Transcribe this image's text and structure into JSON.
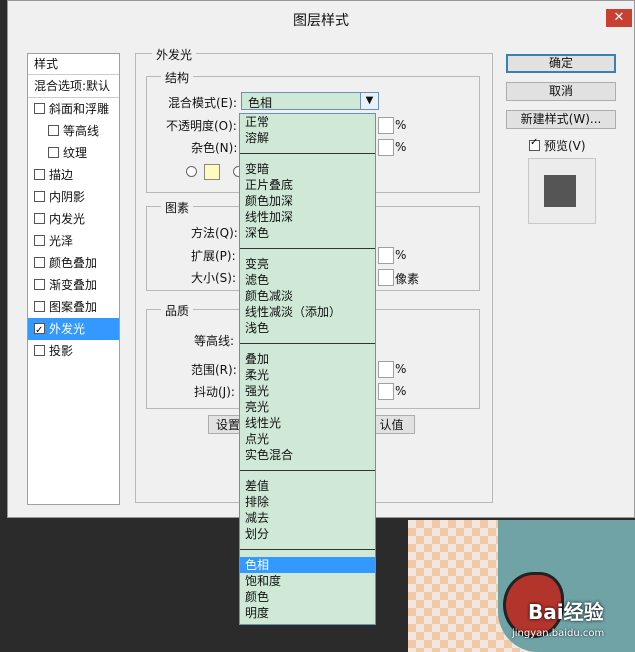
{
  "dialog": {
    "title": "图层样式",
    "close_glyph": "✕"
  },
  "styles_list": {
    "header": "样式",
    "blend_default": "混合选项:默认",
    "items": [
      {
        "label": "斜面和浮雕",
        "checked": false,
        "indent": false,
        "active": false
      },
      {
        "label": "等高线",
        "checked": false,
        "indent": true,
        "active": false
      },
      {
        "label": "纹理",
        "checked": false,
        "indent": true,
        "active": false
      },
      {
        "label": "描边",
        "checked": false,
        "indent": false,
        "active": false
      },
      {
        "label": "内阴影",
        "checked": false,
        "indent": false,
        "active": false
      },
      {
        "label": "内发光",
        "checked": false,
        "indent": false,
        "active": false
      },
      {
        "label": "光泽",
        "checked": false,
        "indent": false,
        "active": false
      },
      {
        "label": "颜色叠加",
        "checked": false,
        "indent": false,
        "active": false
      },
      {
        "label": "渐变叠加",
        "checked": false,
        "indent": false,
        "active": false
      },
      {
        "label": "图案叠加",
        "checked": false,
        "indent": false,
        "active": false
      },
      {
        "label": "外发光",
        "checked": true,
        "indent": false,
        "active": true
      },
      {
        "label": "投影",
        "checked": false,
        "indent": false,
        "active": false
      }
    ]
  },
  "panel": {
    "title": "外发光",
    "structure": {
      "title": "结构",
      "blend_mode_label": "混合模式(E):",
      "blend_mode_value": "色相",
      "opacity_label": "不透明度(O):",
      "noise_label": "杂色(N):",
      "percent": "%"
    },
    "elements": {
      "title": "图素",
      "method_label": "方法(Q):",
      "spread_label": "扩展(P):",
      "size_label": "大小(S):",
      "percent": "%",
      "pixels": "像素"
    },
    "quality": {
      "title": "品质",
      "contour_label": "等高线:",
      "range_label": "范围(R):",
      "jitter_label": "抖动(J):",
      "percent": "%"
    },
    "buttons": {
      "set_default_partial": "设置",
      "reset_default_partial": "认值"
    }
  },
  "right_buttons": {
    "ok": "确定",
    "cancel": "取消",
    "new_style": "新建样式(W)...",
    "preview": "预览(V)",
    "preview_checked": true
  },
  "dropdown": {
    "groups": [
      [
        "正常",
        "溶解"
      ],
      [
        "变暗",
        "正片叠底",
        "颜色加深",
        "线性加深",
        "深色"
      ],
      [
        "变亮",
        "滤色",
        "颜色减淡",
        "线性减淡（添加）",
        "浅色"
      ],
      [
        "叠加",
        "柔光",
        "强光",
        "亮光",
        "线性光",
        "点光",
        "实色混合"
      ],
      [
        "差值",
        "排除",
        "减去",
        "划分"
      ],
      [
        "色相",
        "饱和度",
        "颜色",
        "明度"
      ]
    ],
    "selected": "色相"
  },
  "watermark": {
    "brand": "Bai经验",
    "url": "jingyan.baidu.com"
  }
}
